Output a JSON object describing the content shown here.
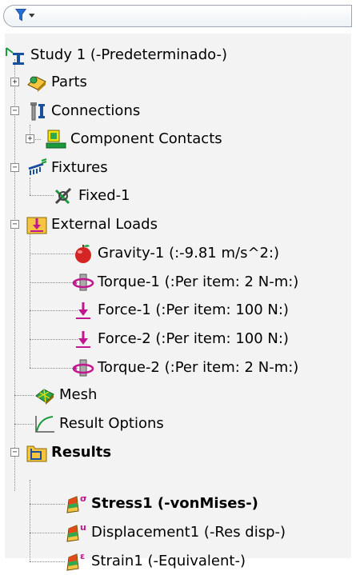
{
  "toolbar": {
    "filter_icon": "filter-icon",
    "dropdown_icon": "dropdown-arrow-icon"
  },
  "tree": {
    "study": {
      "label": "Study 1 (-Predeterminado-)",
      "icon": "study-icon"
    },
    "parts": {
      "label": "Parts",
      "icon": "parts-icon",
      "expander": "+"
    },
    "connections": {
      "label": "Connections",
      "icon": "connections-icon",
      "expander": "−"
    },
    "component_contacts": {
      "label": "Component Contacts",
      "icon": "component-contacts-icon",
      "expander": "+"
    },
    "fixtures": {
      "label": "Fixtures",
      "icon": "fixtures-icon",
      "expander": "−"
    },
    "fixed1": {
      "label": "Fixed-1",
      "icon": "fixed-icon"
    },
    "external_loads": {
      "label": "External Loads",
      "icon": "external-loads-icon",
      "expander": "−"
    },
    "gravity1": {
      "label": "Gravity-1 (:-9.81 m/s^2:)",
      "icon": "gravity-icon"
    },
    "torque1": {
      "label": "Torque-1 (:Per item: 2 N-m:)",
      "icon": "torque-icon"
    },
    "force1": {
      "label": "Force-1 (:Per item: 100 N:)",
      "icon": "force-icon"
    },
    "force2": {
      "label": "Force-2 (:Per item: 100 N:)",
      "icon": "force-icon"
    },
    "torque2": {
      "label": "Torque-2 (:Per item: 2 N-m:)",
      "icon": "torque-icon"
    },
    "mesh": {
      "label": "Mesh",
      "icon": "mesh-icon"
    },
    "result_options": {
      "label": "Result Options",
      "icon": "result-options-icon"
    },
    "results": {
      "label": "Results",
      "icon": "results-folder-icon",
      "expander": "−"
    },
    "stress1": {
      "label": "Stress1 (-vonMises-)",
      "icon": "stress-plot-icon",
      "badge": "σ"
    },
    "displacement1": {
      "label": "Displacement1 (-Res disp-)",
      "icon": "displacement-plot-icon",
      "badge": "u"
    },
    "strain1": {
      "label": "Strain1 (-Equivalent-)",
      "icon": "strain-plot-icon",
      "badge": "ε"
    }
  },
  "colors": {
    "panel_bg": "#f3f3f3",
    "filter_blue": "#2a6fd6",
    "accent_magenta": "#c2188f",
    "folder_yellow": "#f5c542"
  }
}
